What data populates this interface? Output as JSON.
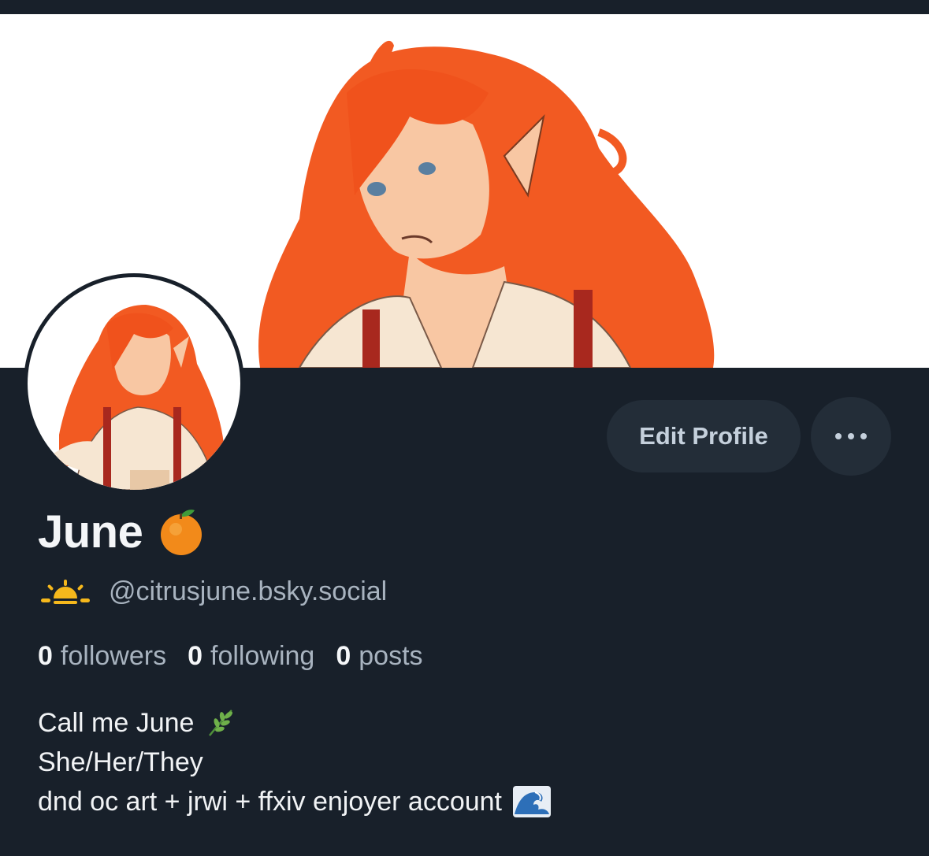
{
  "profile": {
    "name": "June",
    "name_emoji": "orange-emoji",
    "handle_icon": "sunrise-icon",
    "handle": "@citrusjune.bsky.social",
    "edit_label": "Edit Profile",
    "more_label": "•••"
  },
  "stats": [
    {
      "num": "0",
      "label": "followers"
    },
    {
      "num": "0",
      "label": "following"
    },
    {
      "num": "0",
      "label": "posts"
    }
  ],
  "bio": {
    "line1": "Call me June",
    "line1_emoji": "herb-emoji",
    "line2": "She/Her/They",
    "line3": "dnd oc art + jrwi + ffxiv enjoyer account",
    "line3_emoji": "wave-emoji"
  },
  "colors": {
    "background": "#18202a",
    "button": "#232d38",
    "muted_text": "#a8b3bf",
    "hair": "#f25a22"
  }
}
